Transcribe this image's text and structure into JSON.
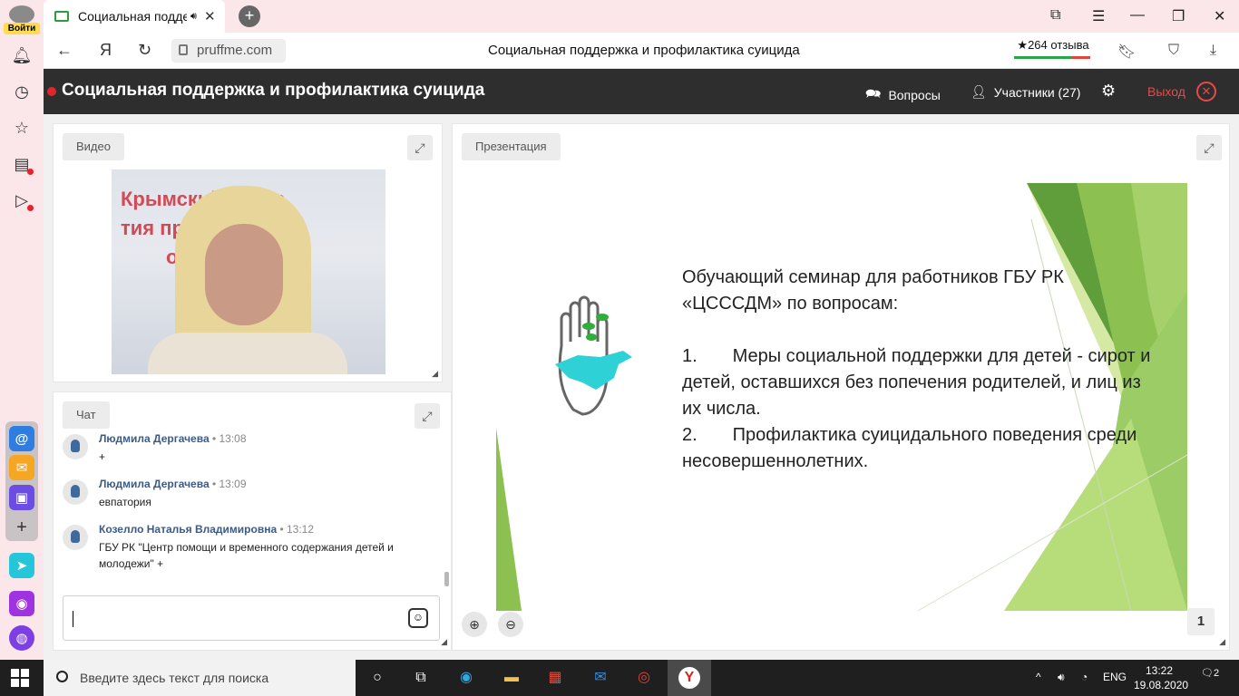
{
  "browser": {
    "login_label": "Войти",
    "tab_title": "Социальная поддер",
    "url": "pruffme.com",
    "page_title": "Социальная поддержка и профилактика суицида",
    "reviews": "★264 отзыва"
  },
  "webinar": {
    "title": "Социальная поддержка и профилактика суицида",
    "questions_label": "Вопросы",
    "participants_label": "Участники (27)",
    "exit_label": "Выход"
  },
  "video_panel": {
    "label": "Видео",
    "banner_line1": "Крымский центр",
    "banner_line2": "тия про альног",
    "banner_line3": "об"
  },
  "chat": {
    "label": "Чат",
    "messages": [
      {
        "author": "Людмила Дергачева",
        "time": "• 13:08",
        "text": "+"
      },
      {
        "author": "Людмила Дергачева",
        "time": "• 13:09",
        "text": "евпатория"
      },
      {
        "author": "Козелло Наталья Владимировна",
        "time": "• 13:12",
        "text": "ГБУ РК \"Центр помощи и временного содержания детей и молодежи\" +"
      }
    ]
  },
  "presentation": {
    "label": "Презентация",
    "slide_line1": "Обучающий семинар для работников ГБУ РК",
    "slide_line2": "«ЦСССДМ» по вопросам:",
    "slide_item1_num": "1.",
    "slide_item1": "Меры социальной поддержки для детей - сирот и детей, оставшихся без попечения родителей, и лиц из их числа.",
    "slide_item2_num": "2.",
    "slide_item2": "Профилактика суицидального поведения среди несовершеннолетних.",
    "page_number": "1"
  },
  "taskbar": {
    "search_placeholder": "Введите здесь текст для поиска",
    "lang": "ENG",
    "time": "13:22",
    "date": "19.08.2020",
    "notifications": "2"
  },
  "colors": {
    "accent_red": "#e0262b",
    "header_bg": "#2e2e2e",
    "slide_green": "#7cb342"
  }
}
